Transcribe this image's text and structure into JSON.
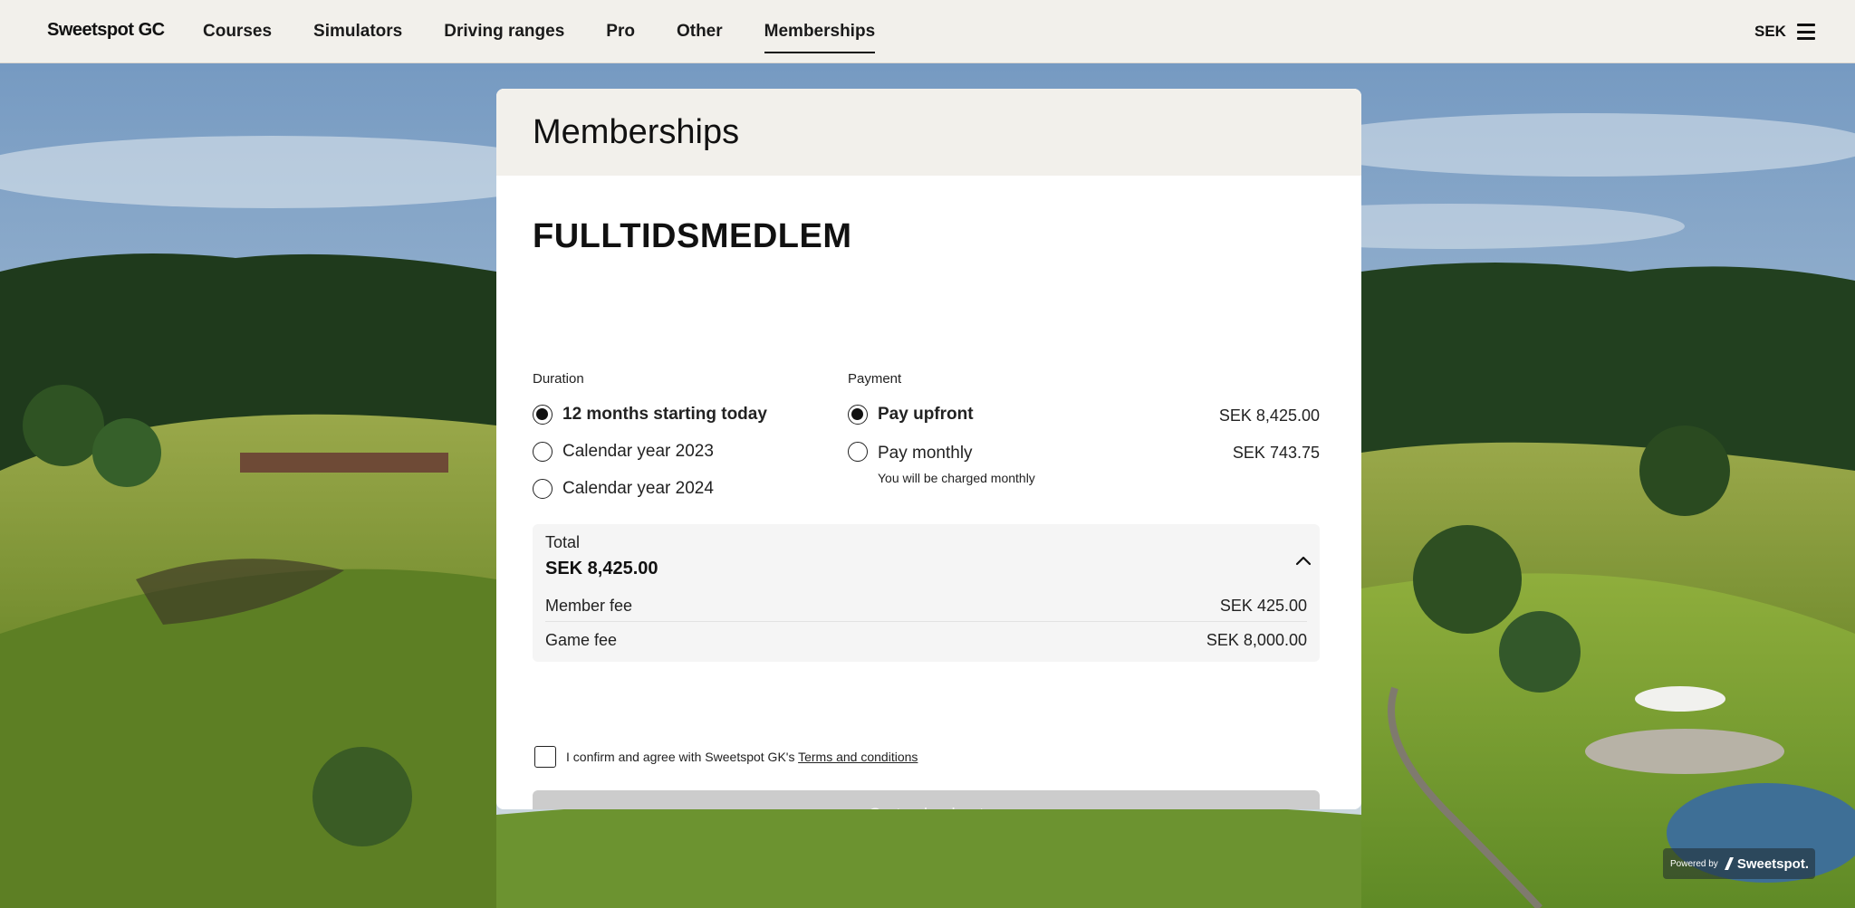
{
  "nav": {
    "logo": "Sweetspot GC",
    "items": [
      {
        "label": "Courses"
      },
      {
        "label": "Simulators"
      },
      {
        "label": "Driving ranges"
      },
      {
        "label": "Pro"
      },
      {
        "label": "Other"
      },
      {
        "label": "Memberships",
        "active": true
      }
    ],
    "currency": "SEK",
    "menu_icon": "hamburger-menu-icon"
  },
  "card": {
    "title": "Memberships",
    "plan_name": "FULLTIDSMEDLEM",
    "duration": {
      "label": "Duration",
      "options": [
        {
          "label": "12 months starting today",
          "selected": true
        },
        {
          "label": "Calendar year 2023",
          "selected": false
        },
        {
          "label": "Calendar year 2024",
          "selected": false
        }
      ]
    },
    "payment": {
      "label": "Payment",
      "options": [
        {
          "label": "Pay upfront",
          "price": "SEK 8,425.00",
          "selected": true
        },
        {
          "label": "Pay monthly",
          "price": "SEK 743.75",
          "selected": false,
          "note": "You will be charged monthly"
        }
      ]
    },
    "total": {
      "label": "Total",
      "value": "SEK 8,425.00",
      "expanded": true,
      "fees": [
        {
          "label": "Member fee",
          "value": "SEK 425.00"
        },
        {
          "label": "Game fee",
          "value": "SEK 8,000.00"
        }
      ]
    },
    "confirm": {
      "text": "I confirm and agree with Sweetspot GK's ",
      "link": "Terms and conditions",
      "checked": false
    },
    "checkout_label": "Go to checkout"
  },
  "powered": {
    "prefix": "Powered by",
    "brand": "Sweetspot."
  },
  "colors": {
    "header_bg": "#f2f0eb",
    "button_disabled": "#cccccc",
    "text": "#111111"
  }
}
